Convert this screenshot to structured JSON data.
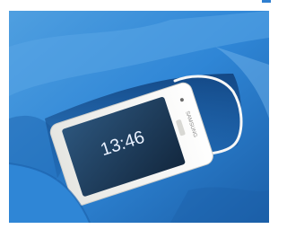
{
  "photo": {
    "subject": "smartphone-in-pocket",
    "colors": {
      "fabric": "#2f86d6",
      "fabric_dark": "#1b5fa8",
      "fabric_light": "#5aa6e6",
      "phone_body": "#f2f2f0",
      "screen": "#1f3c5a",
      "cable": "#f7f7f7"
    },
    "phone": {
      "brand": "SAMSUNG",
      "clock_time": "13:46"
    }
  }
}
